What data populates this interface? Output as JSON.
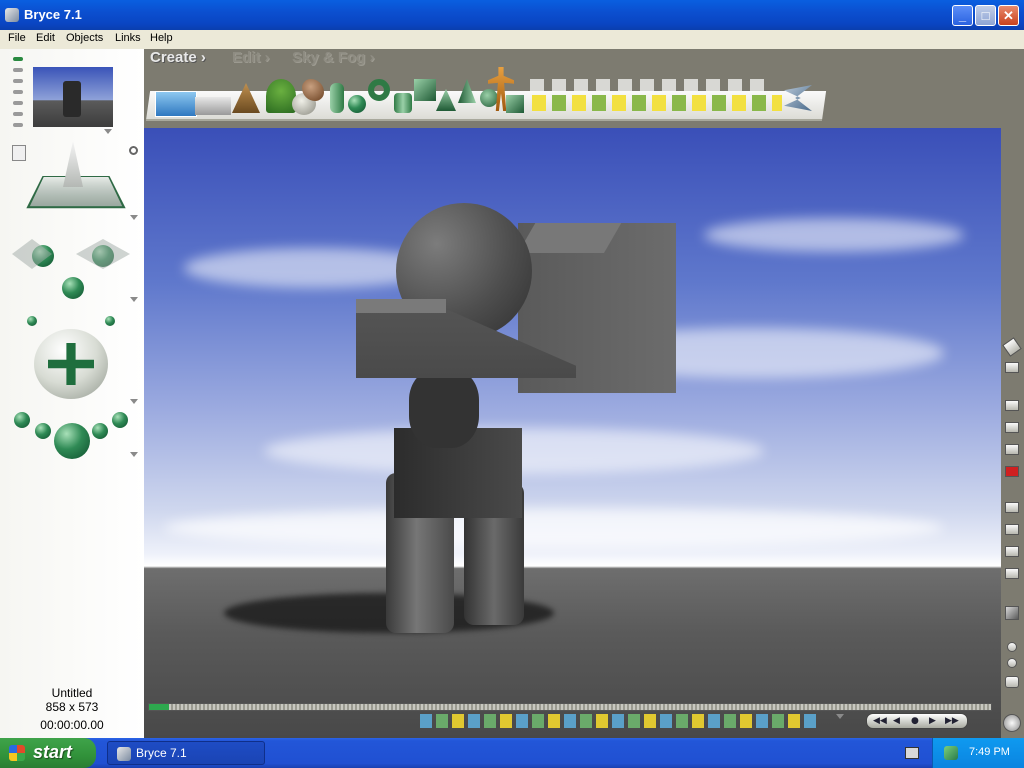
{
  "window": {
    "title": "Bryce 7.1",
    "app_icon": "bryce-icon"
  },
  "window_controls": {
    "minimize_glyph": "_",
    "maximize_glyph": "□",
    "close_glyph": "✕"
  },
  "menubar": {
    "items": [
      "File",
      "Edit",
      "Objects",
      "Links",
      "Help"
    ]
  },
  "palettes": {
    "tabs": [
      "Create",
      "Edit",
      "Sky & Fog"
    ],
    "arrow": "›",
    "active": "Create"
  },
  "scene": {
    "name": "Untitled",
    "dimensions": "858 x 573",
    "time": "00:00:00.00"
  },
  "transport": {
    "glyphs": [
      "◀◀",
      "◀",
      "●",
      "▶",
      "▶▶"
    ]
  },
  "taskbar": {
    "start_label": "start",
    "task_title": "Bryce 7.1",
    "clock": "7:49 PM"
  },
  "colors": {
    "accent_green": "#2f8a55",
    "title_blue": "#0a4fd0",
    "sky_blue": "#3a4fb8"
  }
}
